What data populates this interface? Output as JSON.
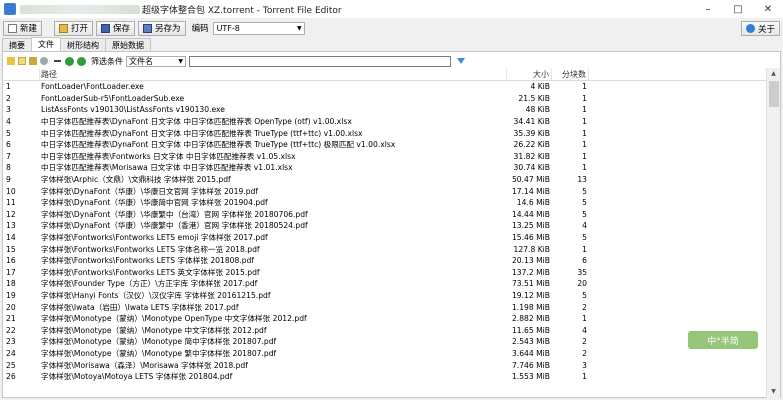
{
  "window": {
    "title": "超级字体整合包 XZ.torrent - Torrent File Editor",
    "minimize": "–",
    "maximize": "□",
    "close": "✕"
  },
  "toolbar": {
    "new_label": "新建",
    "open_label": "打开",
    "save_label": "保存",
    "saveas_label": "另存为",
    "encoding_label": "编码",
    "encoding_value": "UTF-8",
    "about_label": "关于"
  },
  "tabs": [
    "摘要",
    "文件",
    "树形结构",
    "原始数据"
  ],
  "filter": {
    "label": "筛选条件",
    "field_value": "文件名"
  },
  "grid": {
    "columns": [
      "",
      "路径",
      "大小",
      "分块数"
    ],
    "rows": [
      [
        "1",
        "FontLoader\\FontLoader.exe",
        "4 KiB",
        "1"
      ],
      [
        "2",
        "FontLoaderSub-r5\\FontLoaderSub.exe",
        "21.5 KiB",
        "1"
      ],
      [
        "3",
        "ListAssFonts v190130\\ListAssFonts v190130.exe",
        "48 KiB",
        "1"
      ],
      [
        "4",
        "中日字体匹配推荐表\\DynaFont 日文字体 中日字体匹配推荐表 OpenType (otf) v1.00.xlsx",
        "34.41 KiB",
        "1"
      ],
      [
        "5",
        "中日字体匹配推荐表\\DynaFont 日文字体 中日字体匹配推荐表 TrueType (ttf+ttc) v1.00.xlsx",
        "35.39 KiB",
        "1"
      ],
      [
        "6",
        "中日字体匹配推荐表\\DynaFont 日文字体 中日字体匹配推荐表 TrueType (ttf+ttc) 极限匹配 v1.00.xlsx",
        "26.22 KiB",
        "1"
      ],
      [
        "7",
        "中日字体匹配推荐表\\Fontworks 日文字体 中日字体匹配推荐表 v1.05.xlsx",
        "31.82 KiB",
        "1"
      ],
      [
        "8",
        "中日字体匹配推荐表\\Morisawa 日文字体 中日字体匹配推荐表 v1.01.xlsx",
        "30.74 KiB",
        "1"
      ],
      [
        "9",
        "字体样张\\Arphic（文鼎）\\文鼎科技 字体样张 2015.pdf",
        "50.47 MiB",
        "13"
      ],
      [
        "10",
        "字体样张\\DynaFont（华康）\\华康日文官网 字体样张 2019.pdf",
        "17.14 MiB",
        "5"
      ],
      [
        "11",
        "字体样张\\DynaFont（华康）\\华康简中官网 字体样张 201904.pdf",
        "14.6 MiB",
        "5"
      ],
      [
        "12",
        "字体样张\\DynaFont（华康）\\华康繁中（台湾）官网 字体样张 20180706.pdf",
        "14.44 MiB",
        "5"
      ],
      [
        "13",
        "字体样张\\DynaFont（华康）\\华康繁中（香港）官网 字体样张 20180524.pdf",
        "13.25 MiB",
        "4"
      ],
      [
        "14",
        "字体样张\\Fontworks\\Fontworks LETS emoji 字体样张 2017.pdf",
        "15.46 MiB",
        "5"
      ],
      [
        "15",
        "字体样张\\Fontworks\\Fontworks LETS 字体名称一览 2018.pdf",
        "127.8 KiB",
        "1"
      ],
      [
        "16",
        "字体样张\\Fontworks\\Fontworks LETS 字体样张 201808.pdf",
        "20.13 MiB",
        "6"
      ],
      [
        "17",
        "字体样张\\Fontworks\\Fontworks LETS 英文字体样张 2015.pdf",
        "137.2 MiB",
        "35"
      ],
      [
        "18",
        "字体样张\\Founder Type（方正）\\方正字库 字体样张 2017.pdf",
        "73.51 MiB",
        "20"
      ],
      [
        "19",
        "字体样张\\Hanyi Fonts（汉仪）\\汉仪字库 字体样张 20161215.pdf",
        "19.12 MiB",
        "5"
      ],
      [
        "20",
        "字体样张\\Iwata（岩田）\\Iwata LETS 字体样张 2017.pdf",
        "1.198 MiB",
        "2"
      ],
      [
        "21",
        "字体样张\\Monotype（蒙纳）\\Monotype OpenType 中文字体样张 2012.pdf",
        "2.882 MiB",
        "1"
      ],
      [
        "22",
        "字体样张\\Monotype（蒙纳）\\Monotype 中文字体样张 2012.pdf",
        "11.65 MiB",
        "4"
      ],
      [
        "23",
        "字体样张\\Monotype（蒙纳）\\Monotype 简中字体样张 201807.pdf",
        "2.543 MiB",
        "2"
      ],
      [
        "24",
        "字体样张\\Monotype（蒙纳）\\Monotype 繁中字体样张 201807.pdf",
        "3.644 MiB",
        "2"
      ],
      [
        "25",
        "字体样张\\Morisawa（森泽）\\Morisawa 字体样张 2018.pdf",
        "7.746 MiB",
        "3"
      ],
      [
        "26",
        "字体样张\\Motoya\\Motoya LETS 字体样张 201804.pdf",
        "1.553 MiB",
        "1"
      ]
    ]
  },
  "ime": {
    "label": "中°半简"
  }
}
